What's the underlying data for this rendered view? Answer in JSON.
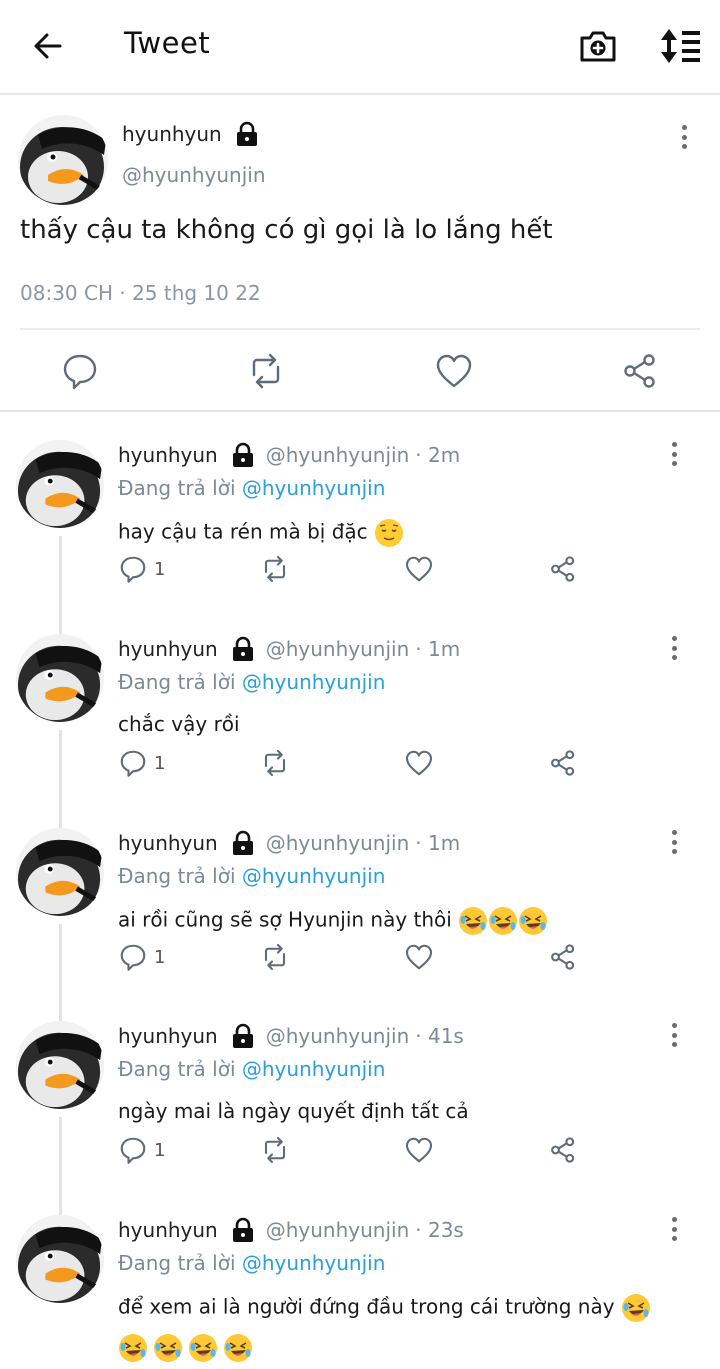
{
  "header": {
    "title": "Tweet",
    "back_icon": "arrow-left-icon",
    "camera_icon": "camera-plus-icon",
    "sort_icon": "sort-list-icon"
  },
  "main_tweet": {
    "name": "hyunhyun",
    "handle": "@hyunhyunjin",
    "text": "thấy cậu ta không có gì gọi là lo lắng hết",
    "time": "08:30 CH · 25 thg 10 22"
  },
  "replies": [
    {
      "name": "hyunhyun",
      "handle": "@hyunhyunjin",
      "age": "· 2m",
      "replying_label": "Đang trả lời",
      "replying_to": "@hyunhyunjin",
      "text": "hay cậu ta rén mà bị đặc",
      "reply_count": "1"
    },
    {
      "name": "hyunhyun",
      "handle": "@hyunhyunjin",
      "age": "· 1m",
      "replying_label": "Đang trả lời",
      "replying_to": "@hyunhyunjin",
      "text": "chắc vậy rồi",
      "reply_count": "1"
    },
    {
      "name": "hyunhyun",
      "handle": "@hyunhyunjin",
      "age": "· 1m",
      "replying_label": "Đang trả lời",
      "replying_to": "@hyunhyunjin",
      "text": "ai rồi cũng sẽ sợ Hyunjin này thôi",
      "reply_count": "1"
    },
    {
      "name": "hyunhyun",
      "handle": "@hyunhyunjin",
      "age": "· 41s",
      "replying_label": "Đang trả lời",
      "replying_to": "@hyunhyunjin",
      "text": "ngày mai là ngày quyết định tất cả",
      "reply_count": "1"
    },
    {
      "name": "hyunhyun",
      "handle": "@hyunhyunjin",
      "age": "· 23s",
      "replying_label": "Đang trả lời",
      "replying_to": "@hyunhyunjin",
      "text": "để xem ai là người đứng đầu trong cái trường này"
    }
  ],
  "colors": {
    "link_blue": "#2a9fd8",
    "muted_gray": "#7d8a96",
    "divider": "#e6e6e6"
  }
}
